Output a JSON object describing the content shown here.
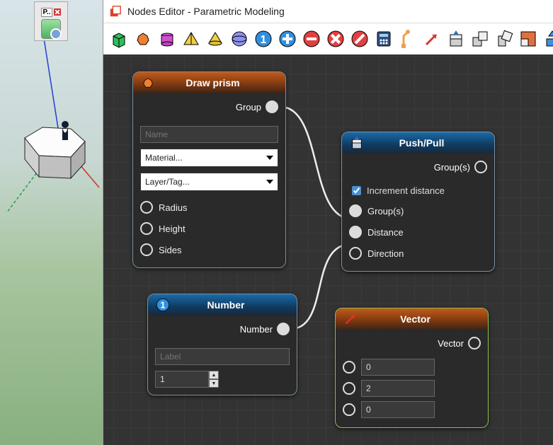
{
  "window": {
    "title": "Nodes Editor - Parametric Modeling"
  },
  "toolbar_icons": [
    "box-icon",
    "prism-icon",
    "cylinder-icon",
    "pyramid-icon",
    "cone-icon",
    "sphere-icon",
    "number-icon",
    "add-icon",
    "subtract-icon",
    "multiply-icon",
    "divide-icon",
    "calculator-icon",
    "point-icon",
    "vector-icon",
    "pushpull-icon",
    "move-icon",
    "rotate-icon",
    "scale-icon",
    "align-icon"
  ],
  "nodes": {
    "prism": {
      "title": "Draw prism",
      "out_group": "Group",
      "name_placeholder": "Name",
      "material_placeholder": "Material...",
      "layer_placeholder": "Layer/Tag...",
      "radius": "Radius",
      "height": "Height",
      "sides": "Sides"
    },
    "number": {
      "title": "Number",
      "out_number": "Number",
      "label_placeholder": "Label",
      "value": "1"
    },
    "pushpull": {
      "title": "Push/Pull",
      "out_groups": "Group(s)",
      "increment": "Increment distance",
      "increment_checked": true,
      "in_groups": "Group(s)",
      "distance": "Distance",
      "direction": "Direction"
    },
    "vector": {
      "title": "Vector",
      "out_vector": "Vector",
      "x": "0",
      "y": "2",
      "z": "0"
    }
  }
}
